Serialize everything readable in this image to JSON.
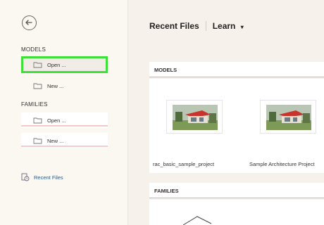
{
  "sidebar": {
    "models_label": "MODELS",
    "models_items": [
      {
        "label": "Open ...",
        "icon": "folder-open-icon"
      },
      {
        "label": "New ...",
        "icon": "folder-new-icon"
      }
    ],
    "families_label": "FAMILIES",
    "families_items": [
      {
        "label": "Open ...",
        "icon": "folder-open-icon"
      },
      {
        "label": "New ...",
        "icon": "folder-new-icon"
      }
    ],
    "recent_files_label": "Recent Files"
  },
  "header": {
    "title": "Recent Files",
    "learn_label": "Learn"
  },
  "main": {
    "models_header": "MODELS",
    "models_files": [
      {
        "name": "rac_basic_sample_project"
      },
      {
        "name": "Sample Architecture Project"
      }
    ],
    "families_header": "FAMILIES"
  },
  "colors": {
    "highlight": "#3ee03a",
    "section_underline": "#f0b83c",
    "link": "#2f5c8c"
  }
}
